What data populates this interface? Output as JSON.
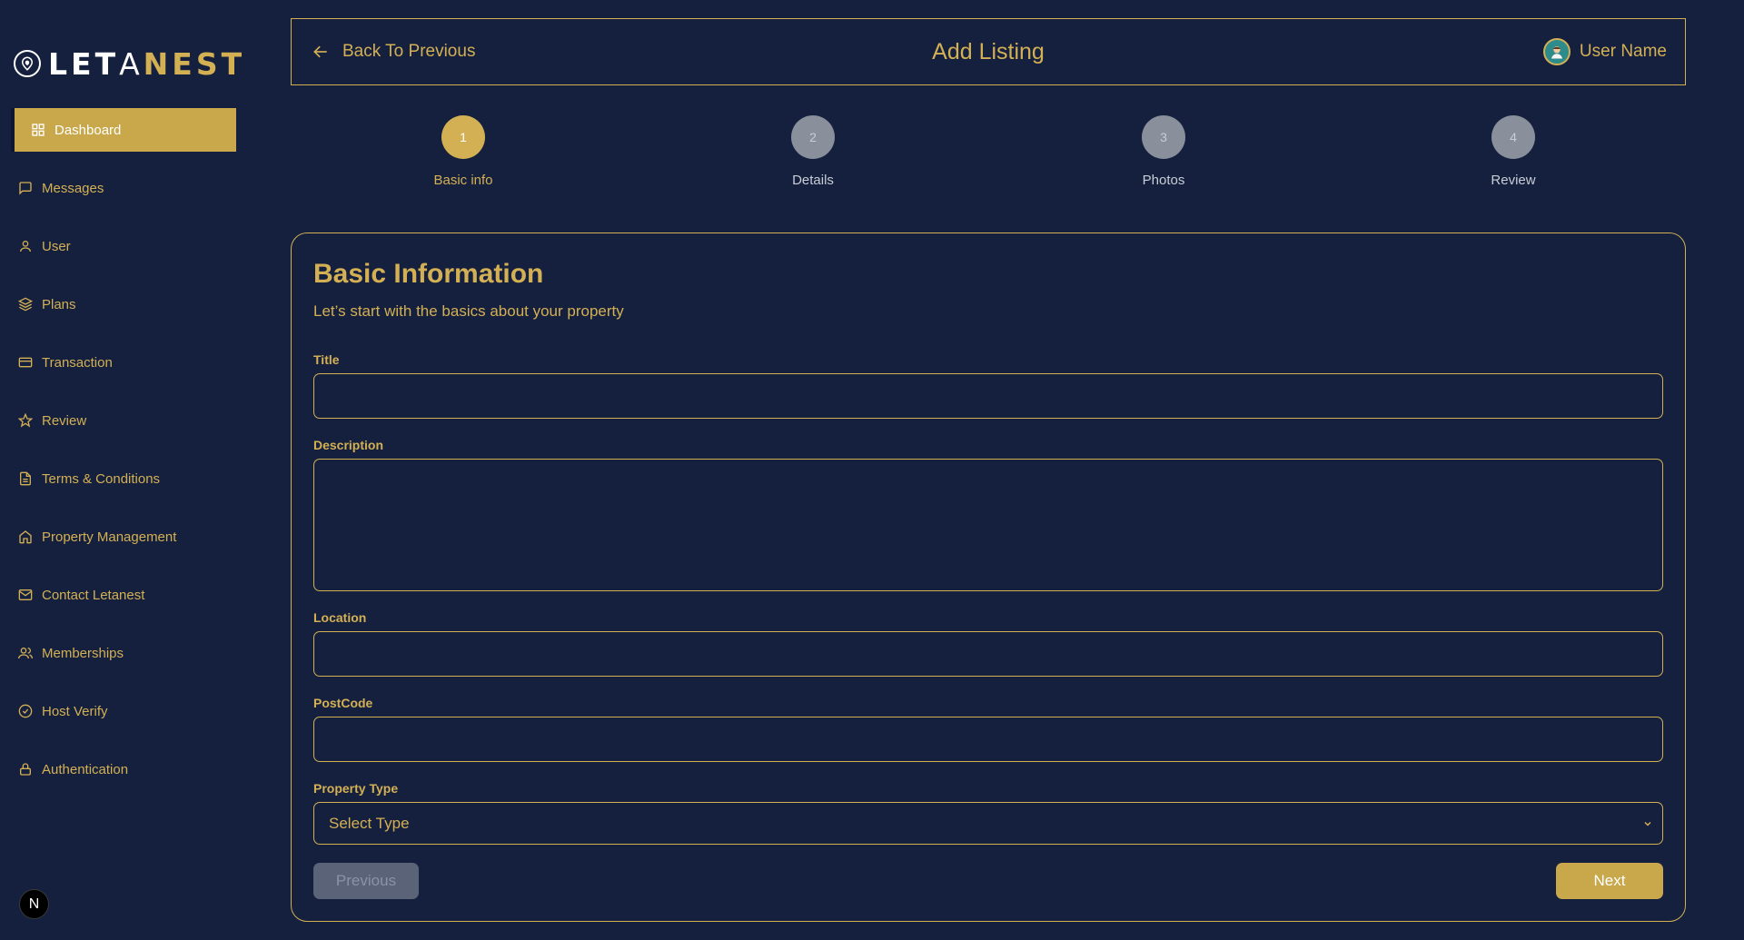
{
  "brand": {
    "part1": "LET",
    "part2": "A",
    "part3": "NEST"
  },
  "sidebar": {
    "items": [
      {
        "label": "Dashboard",
        "icon": "grid-icon",
        "active": true
      },
      {
        "label": "Messages",
        "icon": "message-icon"
      },
      {
        "label": "User",
        "icon": "user-icon"
      },
      {
        "label": "Plans",
        "icon": "layers-icon"
      },
      {
        "label": "Transaction",
        "icon": "card-icon"
      },
      {
        "label": "Review",
        "icon": "star-icon"
      },
      {
        "label": "Terms & Conditions",
        "icon": "document-icon"
      },
      {
        "label": "Property Management",
        "icon": "home-icon"
      },
      {
        "label": "Contact Letanest",
        "icon": "mail-icon"
      },
      {
        "label": "Memberships",
        "icon": "users-icon"
      },
      {
        "label": "Host Verify",
        "icon": "check-circle-icon"
      },
      {
        "label": "Authentication",
        "icon": "lock-icon"
      }
    ],
    "badge": "N"
  },
  "header": {
    "back_label": "Back To Previous",
    "title": "Add Listing",
    "user_name": "User Name"
  },
  "steps": [
    {
      "number": "1",
      "label": "Basic info",
      "active": true
    },
    {
      "number": "2",
      "label": "Details",
      "active": false
    },
    {
      "number": "3",
      "label": "Photos",
      "active": false
    },
    {
      "number": "4",
      "label": "Review",
      "active": false
    }
  ],
  "form": {
    "heading": "Basic Information",
    "subtitle": "Let’s start with the basics about your property",
    "title_label": "Title",
    "title_value": "",
    "description_label": "Description",
    "description_value": "",
    "location_label": "Location",
    "location_value": "",
    "postcode_label": "PostCode",
    "postcode_value": "",
    "property_type_label": "Property Type",
    "property_type_selected": "Select Type",
    "previous_label": "Previous",
    "next_label": "Next"
  },
  "colors": {
    "background": "#14203d",
    "accent": "#d4b055",
    "active_nav": "#c9a84c",
    "disabled_button": "#5b6378",
    "inactive_step": "#8a8f9c"
  }
}
